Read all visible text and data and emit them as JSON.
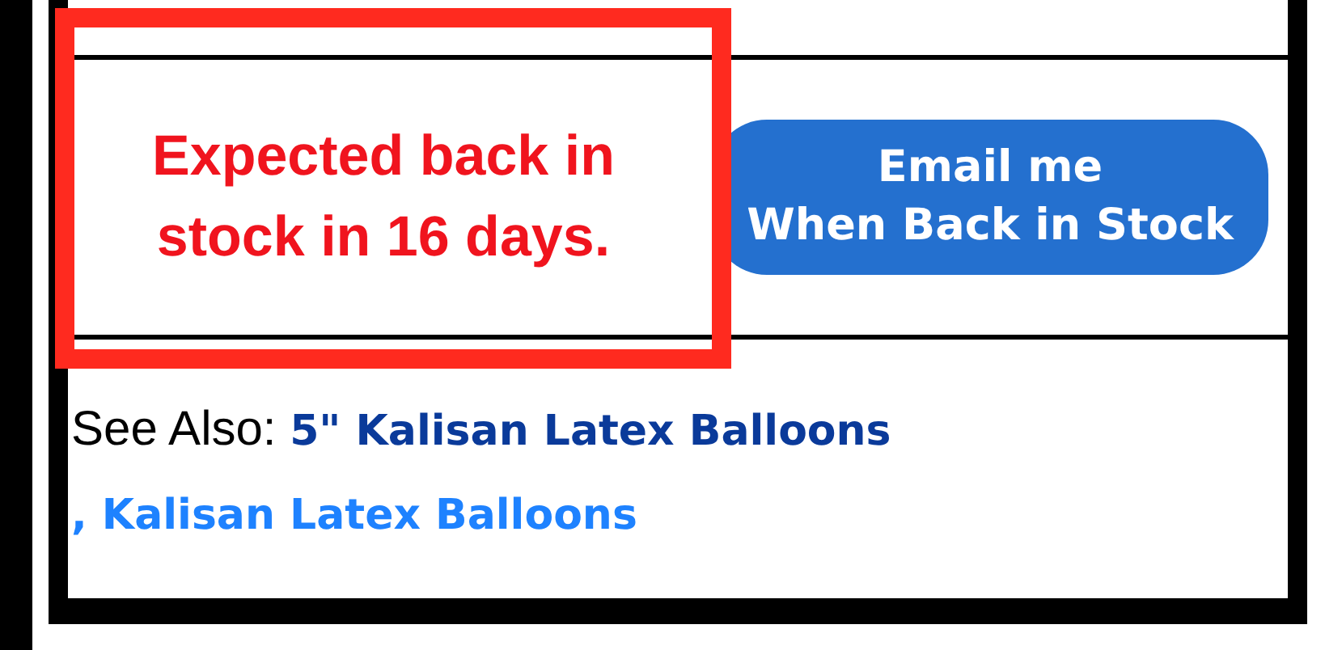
{
  "stock_notice": {
    "text": "Expected back in stock in 16 days.",
    "highlighted": true
  },
  "email_button": {
    "lines": [
      "Email me",
      "When Back in Stock"
    ]
  },
  "see_also": {
    "label": "See Also:",
    "separator": ",",
    "links": [
      {
        "text": "5\" Kalisan Latex Balloons",
        "visited": true
      },
      {
        "text": "Kalisan Latex Balloons",
        "visited": false
      }
    ]
  }
}
